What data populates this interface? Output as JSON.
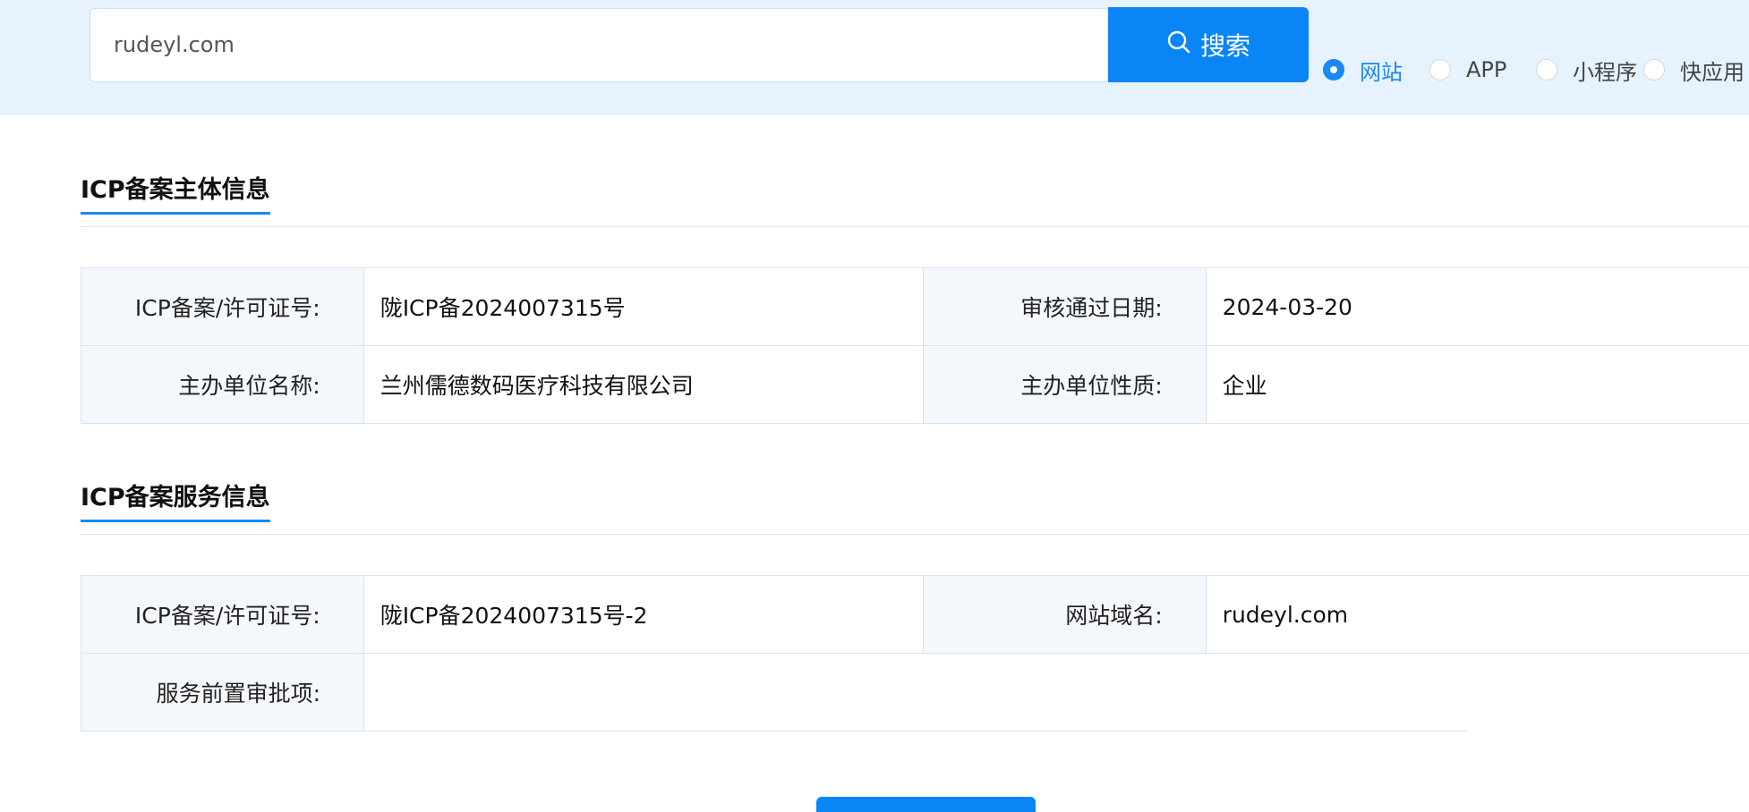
{
  "search": {
    "value": "rudeyl.com",
    "button_label": "搜索",
    "icon": "search-icon"
  },
  "filters": [
    {
      "label": "网站",
      "checked": true
    },
    {
      "label": "APP",
      "checked": false
    },
    {
      "label": "小程序",
      "checked": false
    },
    {
      "label": "快应用",
      "checked": false
    }
  ],
  "subject_section": {
    "title": "ICP备案主体信息",
    "rows": [
      [
        {
          "key": "ICP备案/许可证号:",
          "value": "陇ICP备2024007315号"
        },
        {
          "key": "审核通过日期:",
          "value": "2024-03-20"
        }
      ],
      [
        {
          "key": "主办单位名称:",
          "value": "兰州儒德数码医疗科技有限公司"
        },
        {
          "key": "主办单位性质:",
          "value": "企业"
        }
      ]
    ]
  },
  "service_section": {
    "title": "ICP备案服务信息",
    "rows": [
      [
        {
          "key": "ICP备案/许可证号:",
          "value": "陇ICP备2024007315号-2"
        },
        {
          "key": "网站域名:",
          "value": "rudeyl.com"
        }
      ],
      [
        {
          "key": "服务前置审批项:",
          "value": ""
        }
      ]
    ]
  },
  "colors": {
    "accent": "#1a88f5",
    "button": "#0a85f6",
    "band": "#e6f2fd",
    "key_cell": "#f4f8fc"
  }
}
